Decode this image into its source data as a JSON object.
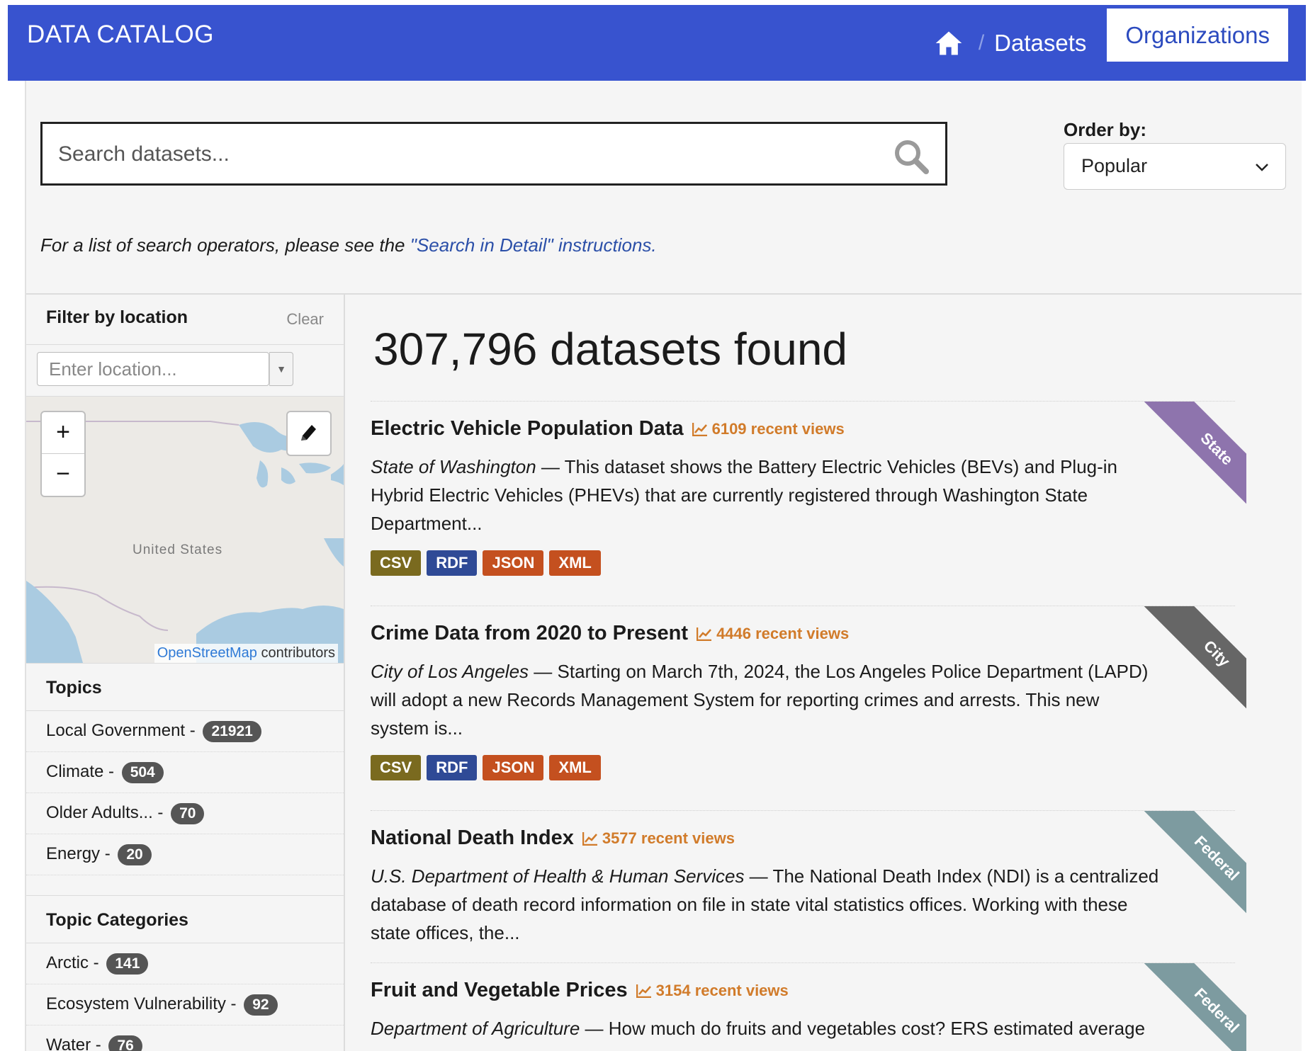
{
  "header": {
    "brand": "DATA CATALOG",
    "separator": "/",
    "nav_datasets": "Datasets",
    "nav_organizations": "Organizations"
  },
  "search": {
    "placeholder": "Search datasets...",
    "order_label": "Order by:",
    "order_value": "Popular",
    "hint_prefix": "For a list of search operators, please see the ",
    "hint_link": "\"Search in Detail\" instructions."
  },
  "sidebar": {
    "location_title": "Filter by location",
    "clear": "Clear",
    "location_placeholder": "Enter location...",
    "zoom_in": "+",
    "zoom_out": "−",
    "map_label": "United States",
    "attribution_link": "OpenStreetMap",
    "attribution_rest": " contributors",
    "topics_title": "Topics",
    "topics": [
      {
        "label": "Local Government -",
        "count": "21921"
      },
      {
        "label": "Climate -",
        "count": "504"
      },
      {
        "label": "Older Adults... -",
        "count": "70"
      },
      {
        "label": "Energy -",
        "count": "20"
      }
    ],
    "categories_title": "Topic Categories",
    "categories": [
      {
        "label": "Arctic -",
        "count": "141"
      },
      {
        "label": "Ecosystem Vulnerability -",
        "count": "92"
      },
      {
        "label": "Water -",
        "count": "76"
      }
    ]
  },
  "results": {
    "count_text": "307,796 datasets found",
    "items": [
      {
        "title": "Electric Vehicle Population Data",
        "views": "6109 recent views",
        "publisher": "State of Washington",
        "dash": " — ",
        "description": "This dataset shows the Battery Electric Vehicles (BEVs) and Plug-in Hybrid Electric Vehicles (PHEVs) that are currently registered through Washington State Department...",
        "formats": [
          "CSV",
          "RDF",
          "JSON",
          "XML"
        ],
        "ribbon": "State"
      },
      {
        "title": "Crime Data from 2020 to Present",
        "views": "4446 recent views",
        "publisher": "City of Los Angeles",
        "dash": " — ",
        "description": "Starting on March 7th, 2024, the Los Angeles Police Department (LAPD) will adopt a new Records Management System for reporting crimes and arrests. This new system is...",
        "formats": [
          "CSV",
          "RDF",
          "JSON",
          "XML"
        ],
        "ribbon": "City"
      },
      {
        "title": "National Death Index",
        "views": "3577 recent views",
        "publisher": "U.S. Department of Health & Human Services",
        "dash": " — ",
        "description": "The National Death Index (NDI) is a centralized database of death record information on file in state vital statistics offices. Working with these state offices, the...",
        "formats": [],
        "ribbon": "Federal"
      },
      {
        "title": "Fruit and Vegetable Prices",
        "views": "3154 recent views",
        "publisher": "Department of Agriculture",
        "dash": " — ",
        "description": "How much do fruits and vegetables cost? ERS estimated average",
        "formats": [],
        "ribbon": "Federal"
      }
    ]
  },
  "colors": {
    "header_bg": "#3853cf",
    "views": "#d17b2a",
    "csv": "#7a6a1f",
    "rdf": "#2f4a96",
    "json": "#c4501f",
    "xml": "#c4501f",
    "ribbon_state": "#8e74ad",
    "ribbon_city": "#666666",
    "ribbon_federal": "#7d9ba0"
  }
}
